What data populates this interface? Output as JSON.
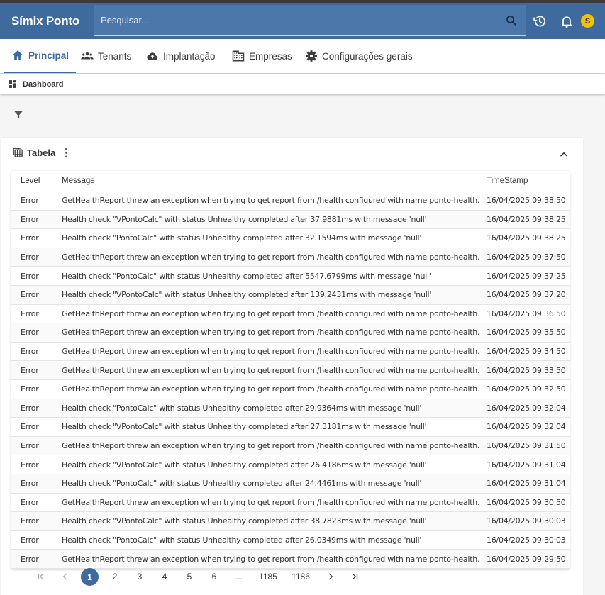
{
  "app": {
    "title": "Símix Ponto",
    "avatar_letter": "S",
    "brand_color": "#3f6a9d"
  },
  "search": {
    "placeholder": "Pesquisar..."
  },
  "icons": {
    "search": "search-icon",
    "history": "history-icon",
    "notifications": "bell-icon",
    "home": "home-icon",
    "tenants": "group-icon",
    "implantacao": "cloud-upload-icon",
    "empresas": "building-icon",
    "config": "gear-icon",
    "dashboard": "dashboard-icon",
    "filter": "filter-icon",
    "table": "table-icon",
    "menu": "more-vert-icon",
    "collapse": "chevron-up-icon"
  },
  "nav": {
    "tabs": [
      {
        "label": "Principal",
        "active": true
      },
      {
        "label": "Tenants"
      },
      {
        "label": "Implantação"
      },
      {
        "label": "Empresas"
      },
      {
        "label": "Configurações gerais"
      }
    ]
  },
  "breadcrumb": {
    "label": "Dashboard"
  },
  "card": {
    "title": "Tabela"
  },
  "table": {
    "columns": [
      "Level",
      "Message",
      "TimeStamp"
    ],
    "rows": [
      [
        "Error",
        "GetHealthReport threw an exception when trying to get report from /health configured with name ponto-health.",
        "16/04/2025 09:38:50"
      ],
      [
        "Error",
        "Health check \"VPontoCalc\" with status Unhealthy completed after 37.9881ms with message 'null'",
        "16/04/2025 09:38:25"
      ],
      [
        "Error",
        "Health check \"PontoCalc\" with status Unhealthy completed after 32.1594ms with message 'null'",
        "16/04/2025 09:38:25"
      ],
      [
        "Error",
        "GetHealthReport threw an exception when trying to get report from /health configured with name ponto-health.",
        "16/04/2025 09:37:50"
      ],
      [
        "Error",
        "Health check \"PontoCalc\" with status Unhealthy completed after 5547.6799ms with message 'null'",
        "16/04/2025 09:37:25"
      ],
      [
        "Error",
        "Health check \"VPontoCalc\" with status Unhealthy completed after 139.2431ms with message 'null'",
        "16/04/2025 09:37:20"
      ],
      [
        "Error",
        "GetHealthReport threw an exception when trying to get report from /health configured with name ponto-health.",
        "16/04/2025 09:36:50"
      ],
      [
        "Error",
        "GetHealthReport threw an exception when trying to get report from /health configured with name ponto-health.",
        "16/04/2025 09:35:50"
      ],
      [
        "Error",
        "GetHealthReport threw an exception when trying to get report from /health configured with name ponto-health.",
        "16/04/2025 09:34:50"
      ],
      [
        "Error",
        "GetHealthReport threw an exception when trying to get report from /health configured with name ponto-health.",
        "16/04/2025 09:33:50"
      ],
      [
        "Error",
        "GetHealthReport threw an exception when trying to get report from /health configured with name ponto-health.",
        "16/04/2025 09:32:50"
      ],
      [
        "Error",
        "Health check \"PontoCalc\" with status Unhealthy completed after 29.9364ms with message 'null'",
        "16/04/2025 09:32:04"
      ],
      [
        "Error",
        "Health check \"VPontoCalc\" with status Unhealthy completed after 27.3181ms with message 'null'",
        "16/04/2025 09:32:04"
      ],
      [
        "Error",
        "GetHealthReport threw an exception when trying to get report from /health configured with name ponto-health.",
        "16/04/2025 09:31:50"
      ],
      [
        "Error",
        "Health check \"VPontoCalc\" with status Unhealthy completed after 26.4186ms with message 'null'",
        "16/04/2025 09:31:04"
      ],
      [
        "Error",
        "Health check \"PontoCalc\" with status Unhealthy completed after 24.4461ms with message 'null'",
        "16/04/2025 09:31:04"
      ],
      [
        "Error",
        "GetHealthReport threw an exception when trying to get report from /health configured with name ponto-health.",
        "16/04/2025 09:30:50"
      ],
      [
        "Error",
        "Health check \"VPontoCalc\" with status Unhealthy completed after 38.7823ms with message 'null'",
        "16/04/2025 09:30:03"
      ],
      [
        "Error",
        "Health check \"PontoCalc\" with status Unhealthy completed after 26.0349ms with message 'null'",
        "16/04/2025 09:30:03"
      ],
      [
        "Error",
        "GetHealthReport threw an exception when trying to get report from /health configured with name ponto-health.",
        "16/04/2025 09:29:50"
      ]
    ]
  },
  "pagination": {
    "current": "1",
    "pages": [
      "1",
      "2",
      "3",
      "4",
      "5",
      "6",
      "...",
      "1185",
      "1186"
    ]
  }
}
